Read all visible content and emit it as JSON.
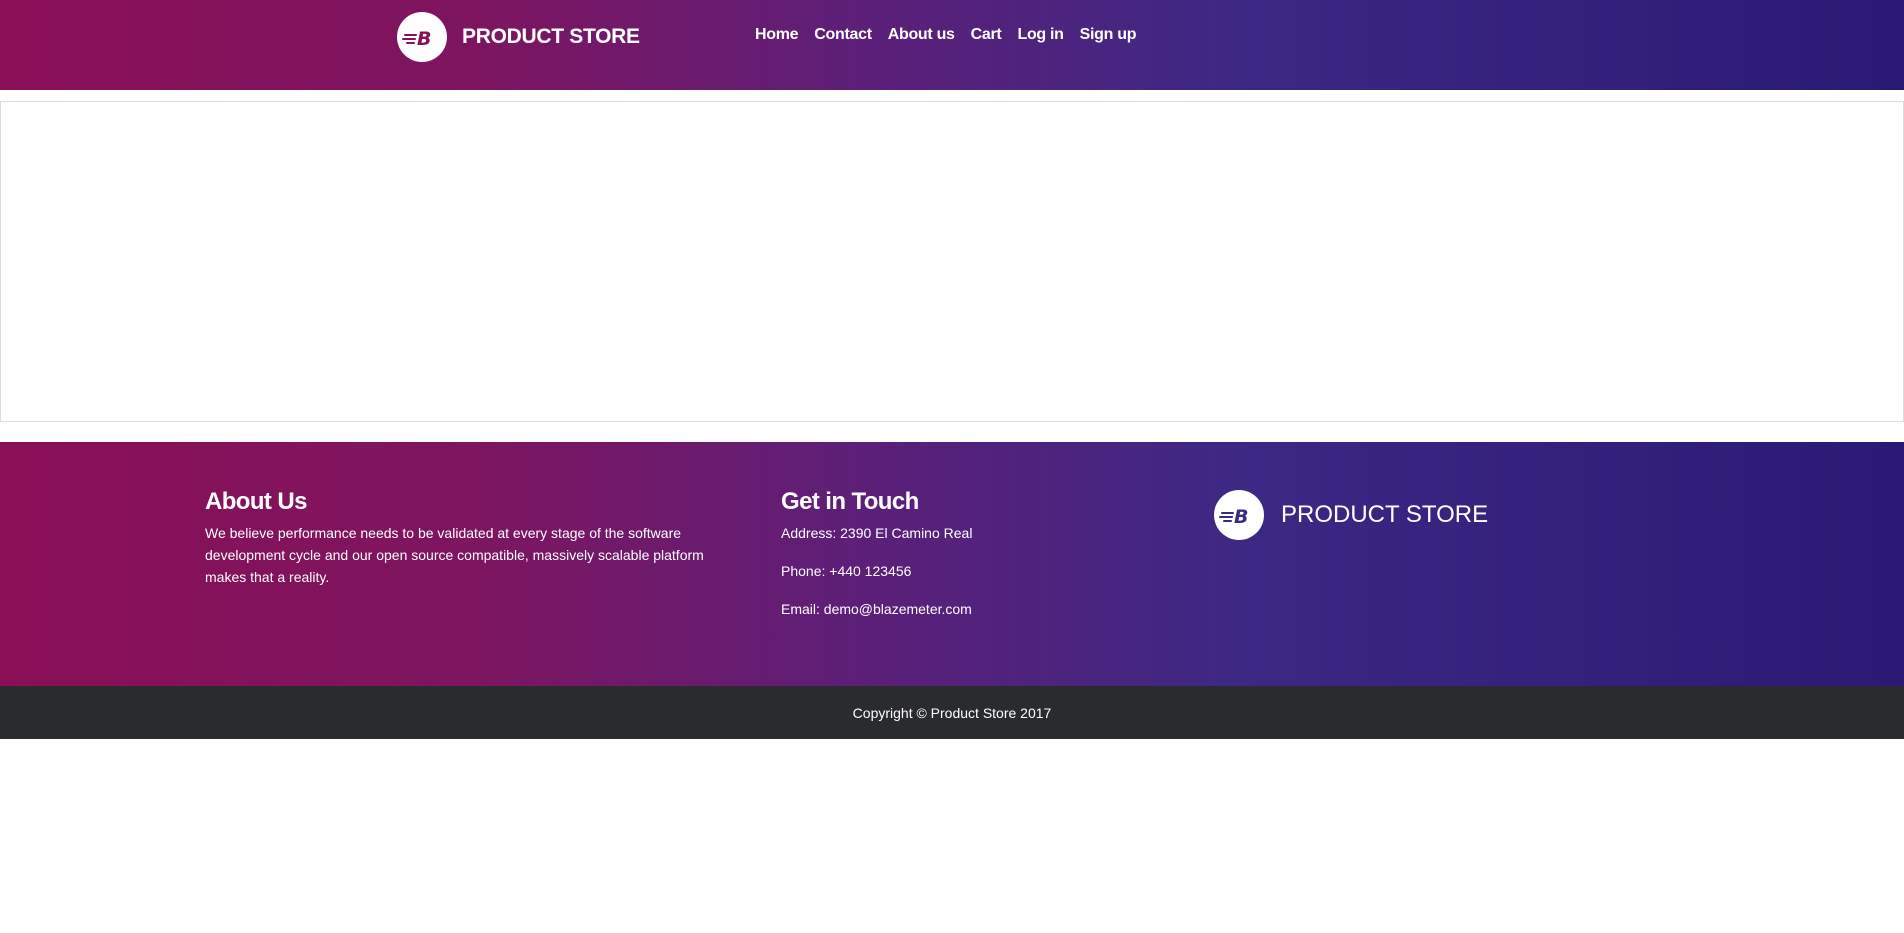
{
  "navbar": {
    "brand": "PRODUCT STORE",
    "logo_icon": "blazemeter-b-logo",
    "links": [
      {
        "label": "Home"
      },
      {
        "label": "Contact"
      },
      {
        "label": "About us"
      },
      {
        "label": "Cart"
      },
      {
        "label": "Log in"
      },
      {
        "label": "Sign up"
      }
    ]
  },
  "footer": {
    "about": {
      "title": "About Us",
      "text": "We believe performance needs to be validated at every stage of the software development cycle and our open source compatible, massively scalable platform makes that a reality."
    },
    "contact": {
      "title": "Get in Touch",
      "address": "Address: 2390 El Camino Real",
      "phone": "Phone: +440 123456",
      "email": "Email: demo@blazemeter.com"
    },
    "brand": "PRODUCT STORE",
    "copyright": "Copyright © Product Store 2017"
  },
  "colors": {
    "gradient_start": "#8a0f57",
    "gradient_end": "#2a1a75",
    "copyright_bg": "#2a2b2d"
  }
}
